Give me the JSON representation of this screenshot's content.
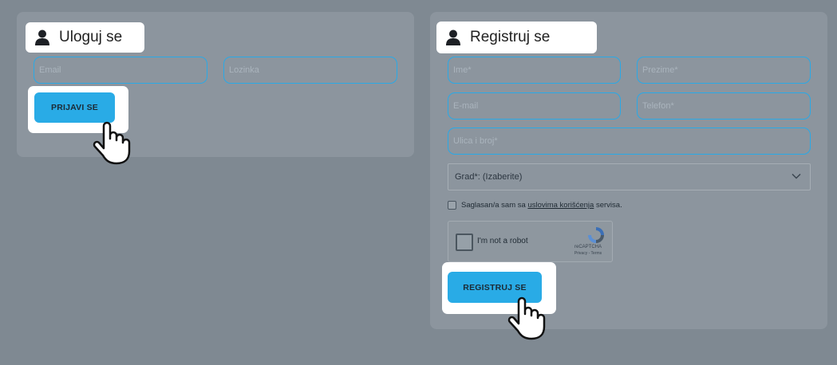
{
  "login": {
    "title": "Uloguj se",
    "email_placeholder": "Email",
    "password_placeholder": "Lozinka",
    "submit_label": "PRIJAVI SE"
  },
  "register": {
    "title": "Registruj se",
    "first_name_placeholder": "Ime*",
    "last_name_placeholder": "Prezime*",
    "email_placeholder": "E-mail",
    "phone_placeholder": "Telefon*",
    "address_placeholder": "Ulica i broj*",
    "city_select": "Grad*: (Izaberite)",
    "consent_prefix": "Saglasan/a sam sa ",
    "consent_link": "uslovima korišćenja",
    "consent_suffix": " servisa.",
    "captcha_label": "I'm not a robot",
    "captcha_brand": "reCAPTCHA",
    "captcha_terms": "Privacy - Terms",
    "submit_label": "REGISTRUJ SE"
  },
  "colors": {
    "accent": "#29abe6",
    "page_bg": "#7f8992",
    "panel_bg": "#8c959e"
  },
  "icons": [
    "user-icon",
    "chevron-down-icon",
    "hand-pointer-icon",
    "recaptcha-logo-icon"
  ]
}
